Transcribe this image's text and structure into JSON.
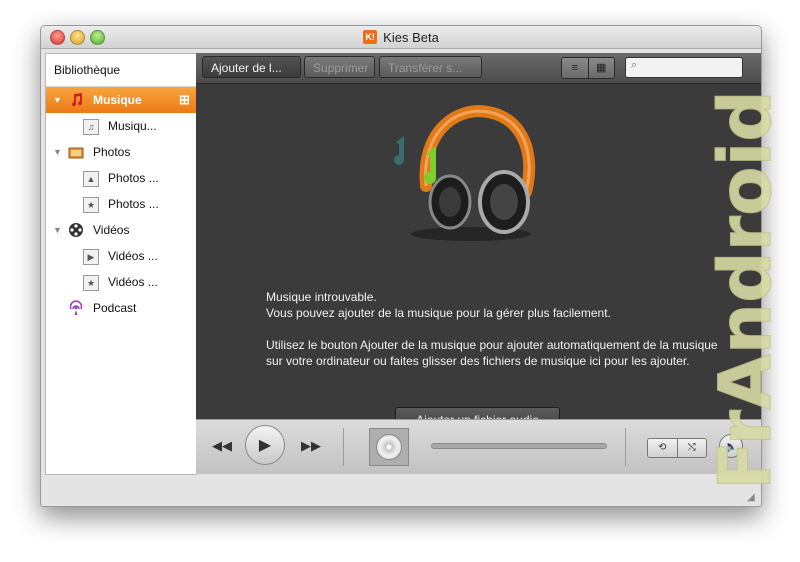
{
  "window": {
    "title": "Kies Beta",
    "logo_text": "K!"
  },
  "sidebar": {
    "header": "Bibliothèque",
    "items": [
      {
        "label": "Musique",
        "level": 0,
        "icon": "music-note-icon",
        "expanded": true,
        "selected": true
      },
      {
        "label": "Musiqu...",
        "level": 1,
        "icon": "music-file-icon"
      },
      {
        "label": "Photos",
        "level": 0,
        "icon": "photos-folder-icon",
        "expanded": true
      },
      {
        "label": "Photos ...",
        "level": 1,
        "icon": "image-file-icon"
      },
      {
        "label": "Photos ...",
        "level": 1,
        "icon": "star-icon"
      },
      {
        "label": "Vidéos",
        "level": 0,
        "icon": "film-reel-icon",
        "expanded": true
      },
      {
        "label": "Vidéos ...",
        "level": 1,
        "icon": "video-file-icon"
      },
      {
        "label": "Vidéos ...",
        "level": 1,
        "icon": "star-icon"
      },
      {
        "label": "Podcast",
        "level": 0,
        "icon": "podcast-icon"
      }
    ]
  },
  "toolbar": {
    "add_label": "Ajouter de l...",
    "delete_label": "Supprimer",
    "transfer_label": "Transférer s...",
    "list_view_icon": "≡",
    "grid_view_icon": "▦",
    "search_placeholder": ""
  },
  "content": {
    "line1": "Musique introuvable.",
    "line2": "Vous pouvez ajouter de la musique pour la gérer plus facilement.",
    "paragraph2": "Utilisez le bouton Ajouter de la musique pour ajouter automatiquement de la musique sur votre ordinateur ou faites glisser des fichiers de musique ici pour les ajouter.",
    "add_audio_label": "Ajouter un fichier audio"
  },
  "player": {
    "prev_icon": "◀◀",
    "play_icon": "▶",
    "next_icon": "▶▶",
    "repeat_icon": "⟲",
    "shuffle_icon": "⤭",
    "mute_icon": "🔈",
    "progress": 0
  },
  "watermark": {
    "text": "FrAndroid"
  },
  "colors": {
    "accent": "#f08a24",
    "toolbar": "#5a5a5a",
    "content_bg": "#3b3b3b"
  }
}
